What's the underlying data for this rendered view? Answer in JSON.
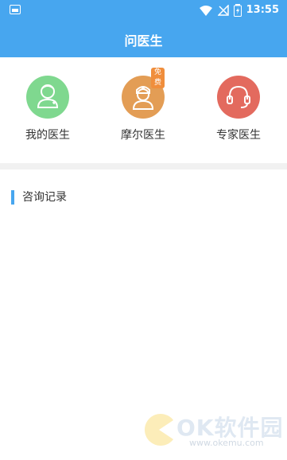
{
  "status": {
    "time": "13:55"
  },
  "header": {
    "title": "问医生"
  },
  "shortcuts": [
    {
      "label": "我的医生",
      "color": "#7fd88f",
      "icon": "doctor-icon"
    },
    {
      "label": "摩尔医生",
      "color": "#e39d55",
      "icon": "nurse-icon",
      "badge": "免费"
    },
    {
      "label": "专家医生",
      "color": "#e36a5e",
      "icon": "headset-icon"
    }
  ],
  "section": {
    "title": "咨询记录"
  },
  "watermark": {
    "text": "OK软件园",
    "sub": "www.okemu.com"
  },
  "colors": {
    "primary": "#47a6ef",
    "background": "#ffffff",
    "divider": "#f1f1f1"
  }
}
